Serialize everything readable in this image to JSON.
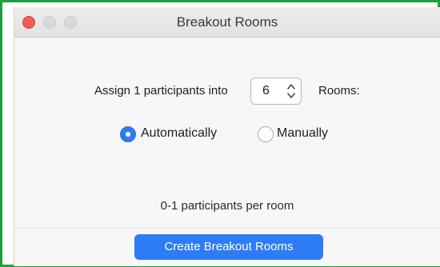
{
  "window": {
    "title": "Breakout Rooms"
  },
  "assign": {
    "prefix_label": "Assign 1 participants into",
    "room_count": "6",
    "suffix_label": "Rooms:"
  },
  "assignment_mode": {
    "options": [
      {
        "label": "Automatically",
        "selected": true
      },
      {
        "label": "Manually",
        "selected": false
      }
    ]
  },
  "summary": {
    "per_room_text": "0-1 participants per room"
  },
  "actions": {
    "create_label": "Create Breakout Rooms"
  },
  "colors": {
    "accent": "#2d7cf6",
    "frame_border": "#1f9e3a",
    "close_button": "#ee5c54"
  },
  "icons": {
    "stepper": "chevron-up-down-icon"
  }
}
